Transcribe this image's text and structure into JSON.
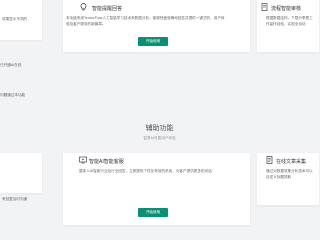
{
  "top_cards": {
    "left_partial": {
      "desc": "效果显示不同的"
    },
    "middle": {
      "title": "智能提醒回答",
      "desc": "本功能采用TensorFlow人工智能学习技术来数据分析，能够快速准确地回答并提供一键式的，用户体验及客户服务的新篇章。",
      "button": "开始使用"
    },
    "right_partial": {
      "title": "流程智能审核",
      "desc": "根据数据结构，下载分享是工作量作经验，实现全自动"
    }
  },
  "middle_partial_texts": {
    "left_a": "已开通AI在线",
    "left_b": "问题通过本功能"
  },
  "section": {
    "title": "辅助功能",
    "subtitle": "智慧AI改善用户体验"
  },
  "bottom_cards": {
    "left_partial": {
      "desc": "有回复及时沟通"
    },
    "middle": {
      "title": "智能AI智能客服",
      "desc": "整体人AI智能行业及行业回答，立即提供个性化有效的系统，为客户提供更多的对话",
      "button": "开始使用"
    },
    "right_partial": {
      "title": "在线文章采集",
      "desc": "通过对数据采集分析技术可以自定义标题抓取"
    }
  },
  "icons": {
    "top_middle": "lightbulb-icon",
    "top_right": "document-icon",
    "bottom_middle": "monitor-chat-icon",
    "bottom_right": "article-icon"
  },
  "colors": {
    "accent": "#0a8f74",
    "background": "#f2f3f5"
  }
}
